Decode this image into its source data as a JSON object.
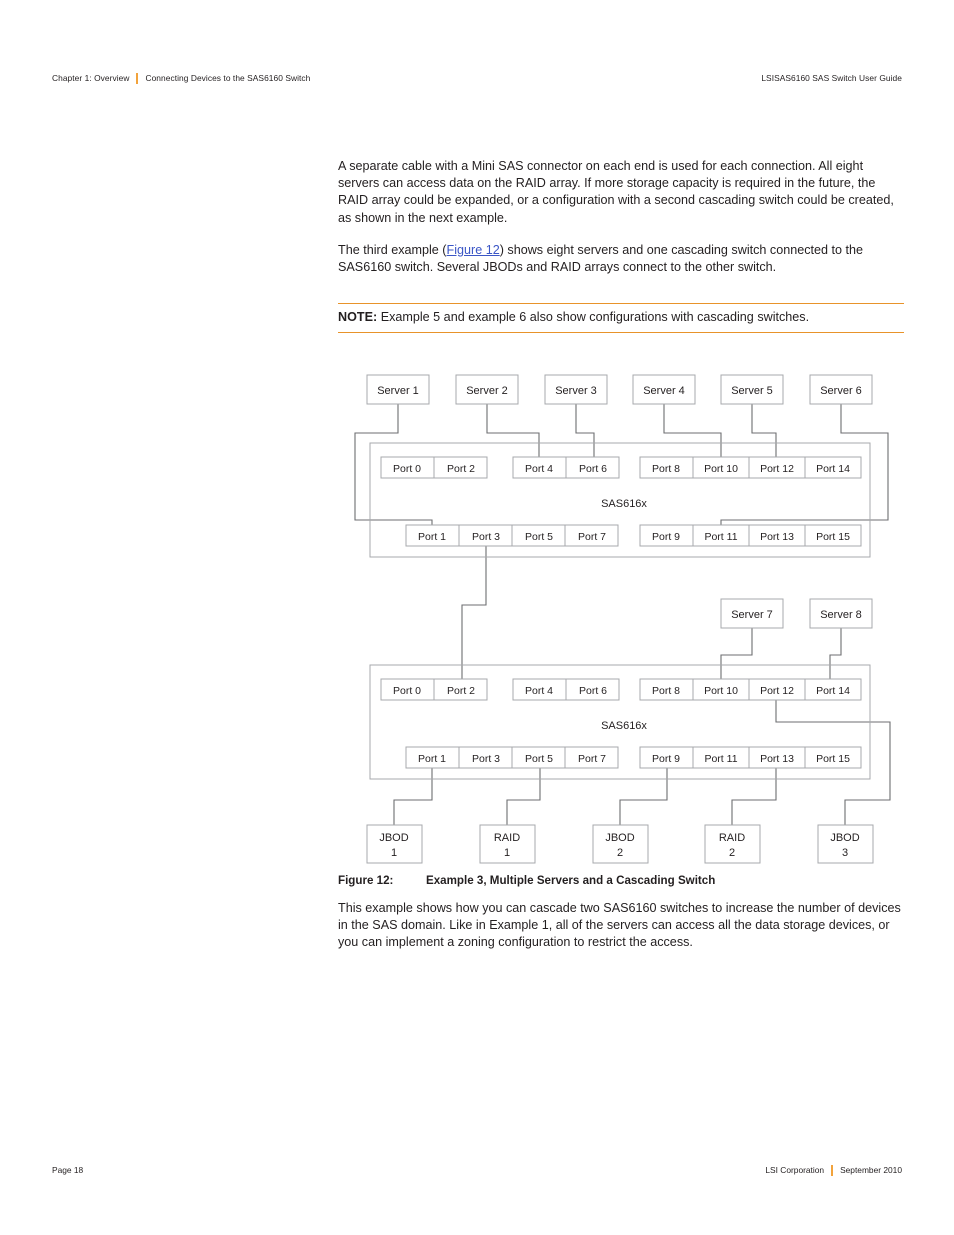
{
  "header": {
    "chapter": "Chapter 1: Overview",
    "section": "Connecting Devices to the SAS6160 Switch",
    "guide": "LSISAS6160 SAS Switch User Guide",
    "divider_color": "#f2a33c"
  },
  "body": {
    "paragraph_1": "A separate cable with a Mini SAS connector on each end is used for each connection. All eight servers can access data on the RAID array. If more storage capacity is required in the future, the RAID array could be expanded, or a configuration with a second cascading switch could be created, as shown in the next example.",
    "paragraph_2_before": "The third example (",
    "paragraph_2_xref": "Figure 12",
    "paragraph_2_after": ") shows eight servers and one cascading switch connected to the SAS6160 switch. Several JBODs and RAID arrays connect to the other switch.",
    "xref_color": "#3b56c6"
  },
  "note": {
    "label": "NOTE:",
    "text": "Example 5 and example 6 also show configurations with cascading switches.",
    "rule_color": "#e8932a"
  },
  "figure": {
    "caption_number": "Figure 12:",
    "caption_text": "Example 3, Multiple Servers and a Cascading Switch",
    "switch_label_top": "SAS616x",
    "switch_label_bottom": "SAS616x",
    "servers_top": [
      "Server 1",
      "Server 2",
      "Server 3",
      "Server 4",
      "Server 5",
      "Server 6"
    ],
    "servers_bottom": [
      "Server 7",
      "Server 8"
    ],
    "storage": [
      "JBOD\n1",
      "RAID\n1",
      "JBOD\n2",
      "RAID\n2",
      "JBOD\n3"
    ],
    "storage_labels": [
      {
        "type": "JBOD",
        "index": "1"
      },
      {
        "type": "RAID",
        "index": "1"
      },
      {
        "type": "JBOD",
        "index": "2"
      },
      {
        "type": "RAID",
        "index": "2"
      },
      {
        "type": "JBOD",
        "index": "3"
      }
    ],
    "switch_top": {
      "even_ports_group_a": [
        "Port 0",
        "Port 2"
      ],
      "even_ports_group_b": [
        "Port 4",
        "Port 6"
      ],
      "even_ports_group_c": [
        "Port 8",
        "Port 10",
        "Port 12",
        "Port 14"
      ],
      "odd_ports_group_a": [
        "Port 1",
        "Port 3",
        "Port 5",
        "Port 7"
      ],
      "odd_ports_group_b": [
        "Port 9",
        "Port 11",
        "Port 13",
        "Port 15"
      ]
    },
    "switch_bottom": {
      "even_ports_group_a": [
        "Port 0",
        "Port 2"
      ],
      "even_ports_group_b": [
        "Port 4",
        "Port 6"
      ],
      "even_ports_group_c": [
        "Port 8",
        "Port 10",
        "Port 12",
        "Port 14"
      ],
      "odd_ports_group_a": [
        "Port 1",
        "Port 3",
        "Port 5",
        "Port 7"
      ],
      "odd_ports_group_b": [
        "Port 9",
        "Port 11",
        "Port 13",
        "Port 15"
      ]
    },
    "line_color": "#58595b",
    "box_border": "#a7a9ac",
    "box_fill": "#ffffff"
  },
  "after_figure": {
    "paragraph": "This example shows how you can cascade two SAS6160 switches to increase the number of devices in the SAS domain. Like in Example 1, all of the servers can access all the data storage devices, or you can implement a zoning configuration to restrict the access."
  },
  "footer": {
    "page": "Page 18",
    "company": "LSI Corporation",
    "date": "September 2010",
    "divider_color": "#f2a33c"
  }
}
